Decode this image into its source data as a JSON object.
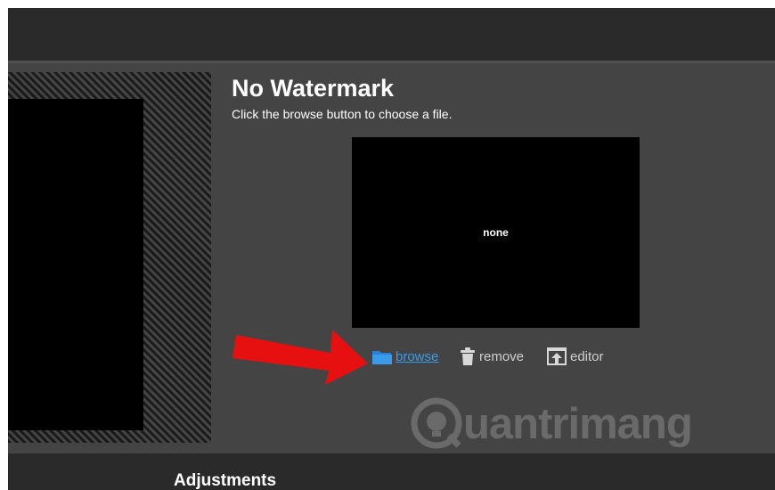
{
  "watermark": {
    "title": "No Watermark",
    "subtitle": "Click the browse button to choose a file.",
    "preview_text": "none"
  },
  "actions": {
    "browse_label": "browse",
    "remove_label": "remove",
    "editor_label": "editor"
  },
  "icons": {
    "browse": "folder-icon",
    "remove": "trash-icon",
    "editor": "upload-icon",
    "annotation": "red-arrow-icon"
  },
  "footer": {
    "section_label": "Adjustments"
  },
  "logo": {
    "text": "uantrimang"
  },
  "colors": {
    "accent_link": "#3a9be8",
    "annotation_arrow": "#e61010",
    "panel_bg": "#444444",
    "bar_bg": "#2a2a2a"
  }
}
